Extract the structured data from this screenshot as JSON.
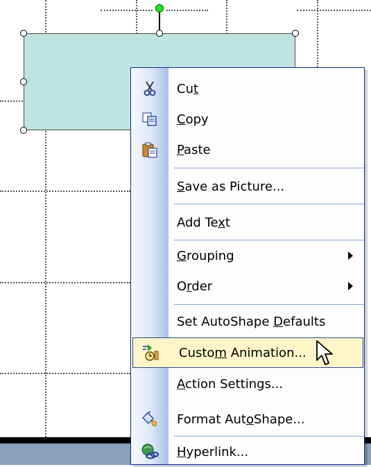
{
  "menu": {
    "items": [
      {
        "id": "cut",
        "pre": "Cu",
        "ul": "t",
        "post": "",
        "icon": "scissors-icon"
      },
      {
        "id": "copy",
        "pre": "",
        "ul": "C",
        "post": "opy",
        "icon": "copy-icon"
      },
      {
        "id": "paste",
        "pre": "",
        "ul": "P",
        "post": "aste",
        "icon": "paste-icon"
      },
      {
        "id": "save-as-picture",
        "pre": "",
        "ul": "S",
        "post": "ave as Picture..."
      },
      {
        "id": "add-text",
        "pre": "Add Te",
        "ul": "x",
        "post": "t"
      },
      {
        "id": "grouping",
        "pre": "",
        "ul": "G",
        "post": "rouping",
        "submenu": true
      },
      {
        "id": "order",
        "pre": "O",
        "ul": "r",
        "post": "der",
        "submenu": true
      },
      {
        "id": "set-autoshape-defaults",
        "pre": "Set AutoShape ",
        "ul": "D",
        "post": "efaults"
      },
      {
        "id": "custom-animation",
        "pre": "Custo",
        "ul": "m",
        "post": " Animation...",
        "icon": "custom-animation-icon",
        "highlighted": true
      },
      {
        "id": "action-settings",
        "pre": "",
        "ul": "A",
        "post": "ction Settings..."
      },
      {
        "id": "format-autoshape",
        "pre": "Format Aut",
        "ul": "o",
        "post": "Shape...",
        "icon": "format-autoshape-icon"
      },
      {
        "id": "hyperlink",
        "pre": "",
        "ul": "H",
        "post": "yperlink...",
        "icon": "hyperlink-icon"
      }
    ]
  },
  "colors": {
    "shape_fill": "#bfe3e0",
    "menu_border": "#002d96",
    "highlight_fill": "#fff5c8",
    "rotation_handle": "#1de51d"
  }
}
